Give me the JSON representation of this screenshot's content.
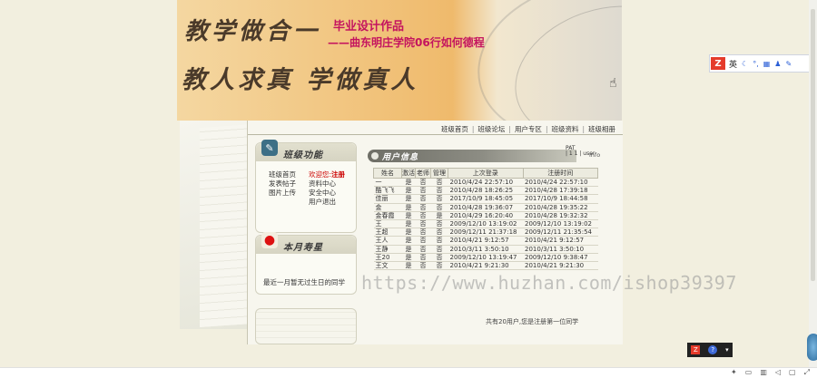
{
  "banner": {
    "calligraphy_line1": "教学做合一",
    "calligraphy_line2": "教人求真 学做真人",
    "title": "毕业设计作品",
    "subtitle": "——曲东明庄学院06行如何德程"
  },
  "nav": {
    "items": [
      "班级首页",
      "班级论坛",
      "用户专区",
      "班级资料",
      "班级相册"
    ]
  },
  "func_box": {
    "title": "班级功能",
    "left_links": [
      "班级首页",
      "发表帖子",
      "图片上传"
    ],
    "welcome_prefix": "欢迎您:",
    "login_label": "注册",
    "right_links": [
      "资料中心",
      "安全中心",
      "用户退出"
    ]
  },
  "birthday_box": {
    "title": "本月寿星",
    "text": "最近一月暂无过生日的同学"
  },
  "user_panel": {
    "title": "用户信息",
    "label_lines": [
      "PAT",
      "| 1 1 | user"
    ],
    "info": "info",
    "headers": [
      "姓名",
      "激活",
      "老师",
      "管理",
      "上次登录",
      "注册时间"
    ],
    "rows": [
      [
        "一",
        "是",
        "否",
        "否",
        "2010/4/24 22:57:10",
        "2010/4/24 22:57:10"
      ],
      [
        "酷飞飞",
        "是",
        "否",
        "否",
        "2010/4/28 18:26:25",
        "2010/4/28 17:39:18"
      ],
      [
        "佳丽",
        "是",
        "否",
        "否",
        "2017/10/9 18:45:05",
        "2017/10/9 18:44:58"
      ],
      [
        "金",
        "是",
        "否",
        "否",
        "2010/4/28 19:36:07",
        "2010/4/28 19:35:22"
      ],
      [
        "金春霞",
        "是",
        "否",
        "是",
        "2010/4/29 16:20:40",
        "2010/4/28 19:32:32"
      ],
      [
        "王",
        "是",
        "否",
        "否",
        "2009/12/10 13:19:02",
        "2009/12/10 13:19:02"
      ],
      [
        "王超",
        "是",
        "否",
        "否",
        "2009/12/11 21:37:18",
        "2009/12/11 21:35:54"
      ],
      [
        "王人",
        "是",
        "否",
        "否",
        "2010/4/21 9:12:57",
        "2010/4/21 9:12:57"
      ],
      [
        "王静",
        "是",
        "否",
        "否",
        "2010/3/11 3:50:10",
        "2010/3/11 3:50:10"
      ],
      [
        "王20",
        "是",
        "否",
        "否",
        "2009/12/10 13:19:47",
        "2009/12/10 9:38:47"
      ],
      [
        "王文",
        "是",
        "否",
        "否",
        "2010/4/21 9:21:30",
        "2010/4/21 9:21:30"
      ]
    ],
    "stat_line": "共有20用户,您是注册第一位同学"
  },
  "watermark": "https://www.huzhan.com/ishop39397",
  "ime": {
    "logo": "Z",
    "lang": "英"
  },
  "widget": {
    "w1": "Z",
    "w2": "?"
  }
}
